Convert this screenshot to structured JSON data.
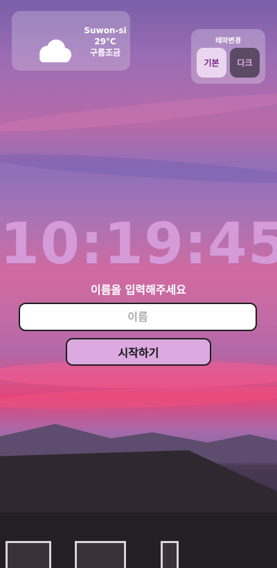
{
  "weather": {
    "city": "Suwon-si",
    "temperature": "29°C",
    "condition": "구름조금",
    "icon": "cloud-icon"
  },
  "theme": {
    "title": "테마변경",
    "basic_label": "기본",
    "dark_label": "다크"
  },
  "clock": {
    "time": "10:19:45"
  },
  "login": {
    "prompt": "이름을 입력해주세요",
    "name_placeholder": "이름",
    "name_value": "",
    "start_label": "시작하기"
  },
  "colors": {
    "accent": "#dcaae0",
    "clock": "#d59ad8"
  }
}
